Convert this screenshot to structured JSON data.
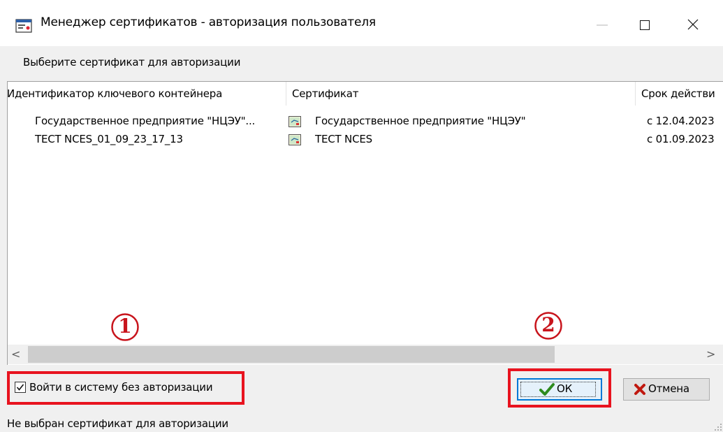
{
  "window": {
    "title": "Менеджер сертификатов - авторизация пользователя",
    "controls": {
      "minimize": "—",
      "maximize": "☐",
      "close": "✕"
    }
  },
  "prompt": "Выберите сертификат для авторизации",
  "table": {
    "columns": [
      "Идентификатор ключевого контейнера",
      "Сертификат",
      "Срок действи"
    ],
    "rows": [
      {
        "container": "Государственное предприятие \"НЦЭУ\"...",
        "certificate": "Государственное предприятие \"НЦЭУ\"",
        "validity": "с 12.04.2023"
      },
      {
        "container": "TECT NCES_01_09_23_17_13",
        "certificate": "TECT NCES",
        "validity": "с 01.09.2023"
      }
    ]
  },
  "scrollbar": {
    "left_arrow": "<",
    "right_arrow": ">"
  },
  "callouts": {
    "one": "1",
    "two": "2"
  },
  "checkbox": {
    "label": "Войти в систему без авторизации",
    "checked": true
  },
  "buttons": {
    "ok": "ОК",
    "cancel": "Отмена"
  },
  "status": "Не выбран сертификат для авторизации",
  "colors": {
    "highlight": "#e8131f",
    "accent": "#0078d7",
    "ok_check": "#2e8b1e",
    "cancel_x": "#c0180f"
  }
}
